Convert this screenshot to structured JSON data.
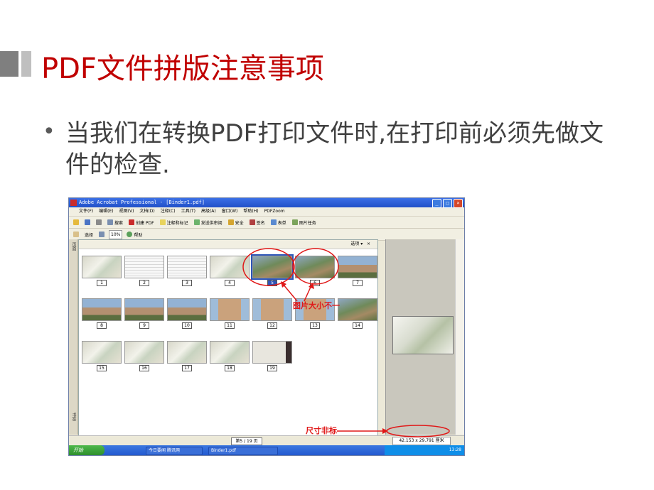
{
  "slide": {
    "title": "PDF文件拼版注意事项",
    "bullet": "当我们在转换PDF打印文件时,在打印前必须先做文件的检查."
  },
  "screenshot": {
    "window_title": "Adobe Acrobat Professional - [Binder1.pdf]",
    "menu": [
      "文件(F)",
      "编辑(E)",
      "视图(V)",
      "文档(D)",
      "注释(C)",
      "工具(T)",
      "高级(A)",
      "窗口(W)",
      "帮助(H)",
      "PDFZoom"
    ],
    "toolbar1": [
      "搜索",
      "创建 PDF",
      "注释和标记",
      "发送供审阅",
      "安全",
      "签名",
      "表单",
      "图片任务"
    ],
    "toolbar2": [
      "选择",
      "10%",
      "帮助"
    ],
    "nav_tab_pages": "页面",
    "nav_tab_bookmarks": "书签",
    "pane_options": "选项",
    "thumbnails": [
      {
        "label": "1",
        "kind": "map"
      },
      {
        "label": "2",
        "kind": "doc"
      },
      {
        "label": "3",
        "kind": "doc"
      },
      {
        "label": "4",
        "kind": "map"
      },
      {
        "label": "5",
        "kind": "aerial",
        "selected": true
      },
      {
        "label": "6",
        "kind": "aerial"
      },
      {
        "label": "7",
        "kind": "house"
      },
      {
        "label": "8",
        "kind": "house"
      },
      {
        "label": "9",
        "kind": "house"
      },
      {
        "label": "10",
        "kind": "house"
      },
      {
        "label": "11",
        "kind": "tower"
      },
      {
        "label": "12",
        "kind": "tower"
      },
      {
        "label": "13",
        "kind": "tower"
      },
      {
        "label": "14",
        "kind": "aerial"
      },
      {
        "label": "15",
        "kind": "map"
      },
      {
        "label": "16",
        "kind": "map"
      },
      {
        "label": "17",
        "kind": "map"
      },
      {
        "label": "18",
        "kind": "map"
      },
      {
        "label": "19",
        "kind": "dark"
      }
    ],
    "page_indicator": "第5 / 19 页",
    "page_size": "42.153 x 29.791 厘米",
    "taskbar_start": "开始",
    "taskbar_items": [
      "今日要闻 腾讯网",
      "Binder1.pdf"
    ],
    "clock": "13:28"
  },
  "annotations": {
    "size_mismatch": "图片大小不一",
    "nonstandard_size": "尺寸非标"
  }
}
